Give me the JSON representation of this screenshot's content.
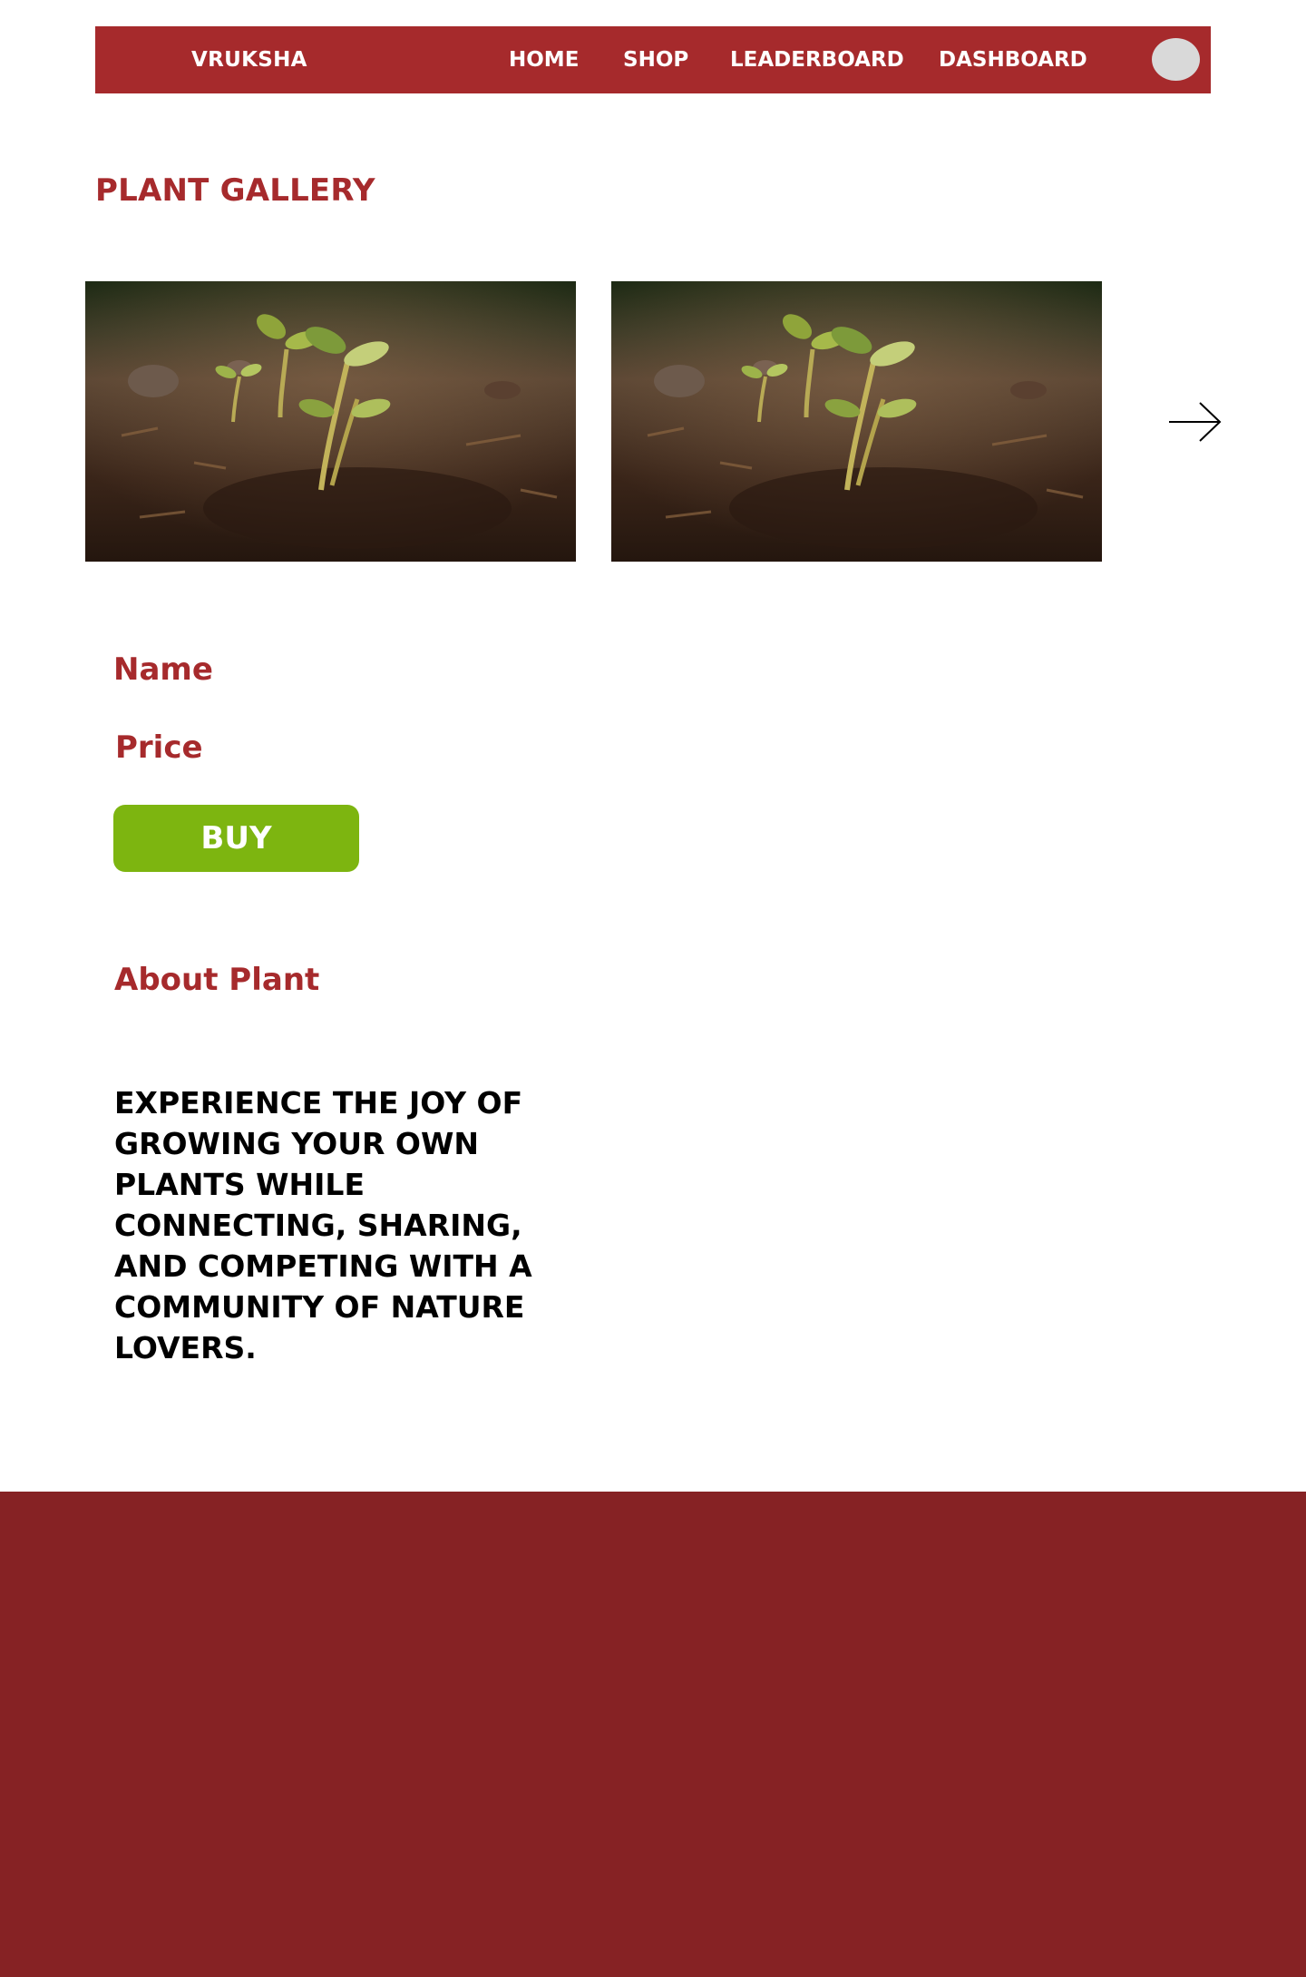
{
  "header": {
    "brand": "VRUKSHA",
    "nav": {
      "home": "HOME",
      "shop": "SHOP",
      "leaderboard": "LEADERBOARD",
      "dashboard": "DASHBOARD"
    }
  },
  "gallery": {
    "title": "PLANT GALLERY"
  },
  "product": {
    "name_label": "Name",
    "price_label": "Price",
    "buy_label": "BUY"
  },
  "about": {
    "heading": "About Plant",
    "text": "EXPERIENCE THE JOY OF GROWING YOUR OWN PLANTS WHILE CONNECTING, SHARING, AND COMPETING WITH A COMMUNITY OF NATURE LOVERS."
  },
  "colors": {
    "brand_red": "#a62a2c",
    "footer_red": "#862224",
    "buy_green": "#7db510",
    "avatar_gray": "#d9d9d9"
  },
  "icons": {
    "next": "arrow-right-icon",
    "avatar": "user-avatar"
  }
}
